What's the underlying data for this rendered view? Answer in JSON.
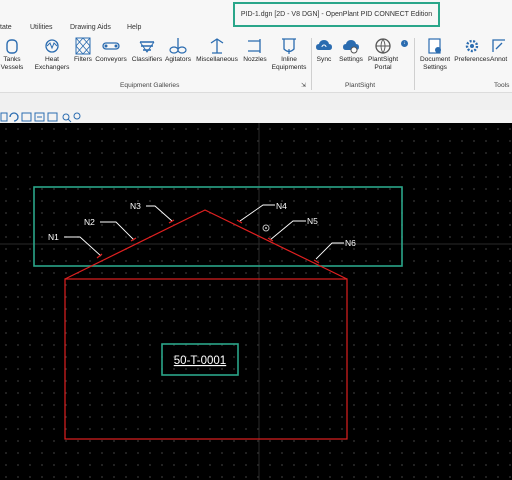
{
  "window": {
    "title": "PID-1.dgn [2D - V8 DGN] - OpenPlant PID CONNECT Edition"
  },
  "menu": {
    "items": [
      "tate",
      "Utilities",
      "Drawing Aids",
      "Help"
    ]
  },
  "ribbon": {
    "equipment_buttons": [
      {
        "label_line1": "Tanks",
        "label_line2": "Vessels",
        "icon": "tank-icon"
      },
      {
        "label_line1": "Heat",
        "label_line2": "Exchangers",
        "icon": "heat-exchanger-icon"
      },
      {
        "label_line1": "Filters",
        "label_line2": "",
        "icon": "filter-icon"
      },
      {
        "label_line1": "Conveyors",
        "label_line2": "",
        "icon": "conveyor-icon"
      },
      {
        "label_line1": "Classifiers",
        "label_line2": "",
        "icon": "classifier-icon"
      },
      {
        "label_line1": "Agitators",
        "label_line2": "",
        "icon": "agitator-icon"
      },
      {
        "label_line1": "Miscellaneous",
        "label_line2": "",
        "icon": "miscellaneous-icon"
      },
      {
        "label_line1": "Nozzles",
        "label_line2": "",
        "icon": "nozzle-icon"
      },
      {
        "label_line1": "Inline",
        "label_line2": "Equipments",
        "icon": "inline-equipment-icon"
      }
    ],
    "plantsight_buttons": [
      {
        "label_line1": "Sync",
        "label_line2": "",
        "icon": "sync-icon"
      },
      {
        "label_line1": "Settings",
        "label_line2": "",
        "icon": "settings-icon"
      },
      {
        "label_line1": "PlantSight",
        "label_line2": "Portal",
        "icon": "portal-icon"
      }
    ],
    "tools_buttons": [
      {
        "label_line1": "Document",
        "label_line2": "Settings",
        "icon": "document-settings-icon"
      },
      {
        "label_line1": "Preferences",
        "label_line2": "",
        "icon": "preferences-icon"
      },
      {
        "label_line1": "Annot",
        "label_line2": "",
        "icon": "annotation-icon"
      }
    ],
    "groups": {
      "equipment": "Equipment Galleries",
      "plantsight": "PlantSight",
      "tools": "Tools"
    }
  },
  "drawing": {
    "nozzles": [
      "N1",
      "N2",
      "N3",
      "N4",
      "N5",
      "N6"
    ],
    "tag": "50-T-0001",
    "colors": {
      "equipment": "#e02020",
      "highlight": "#2aa68a",
      "leader": "#ffffff",
      "background": "#000000"
    }
  }
}
